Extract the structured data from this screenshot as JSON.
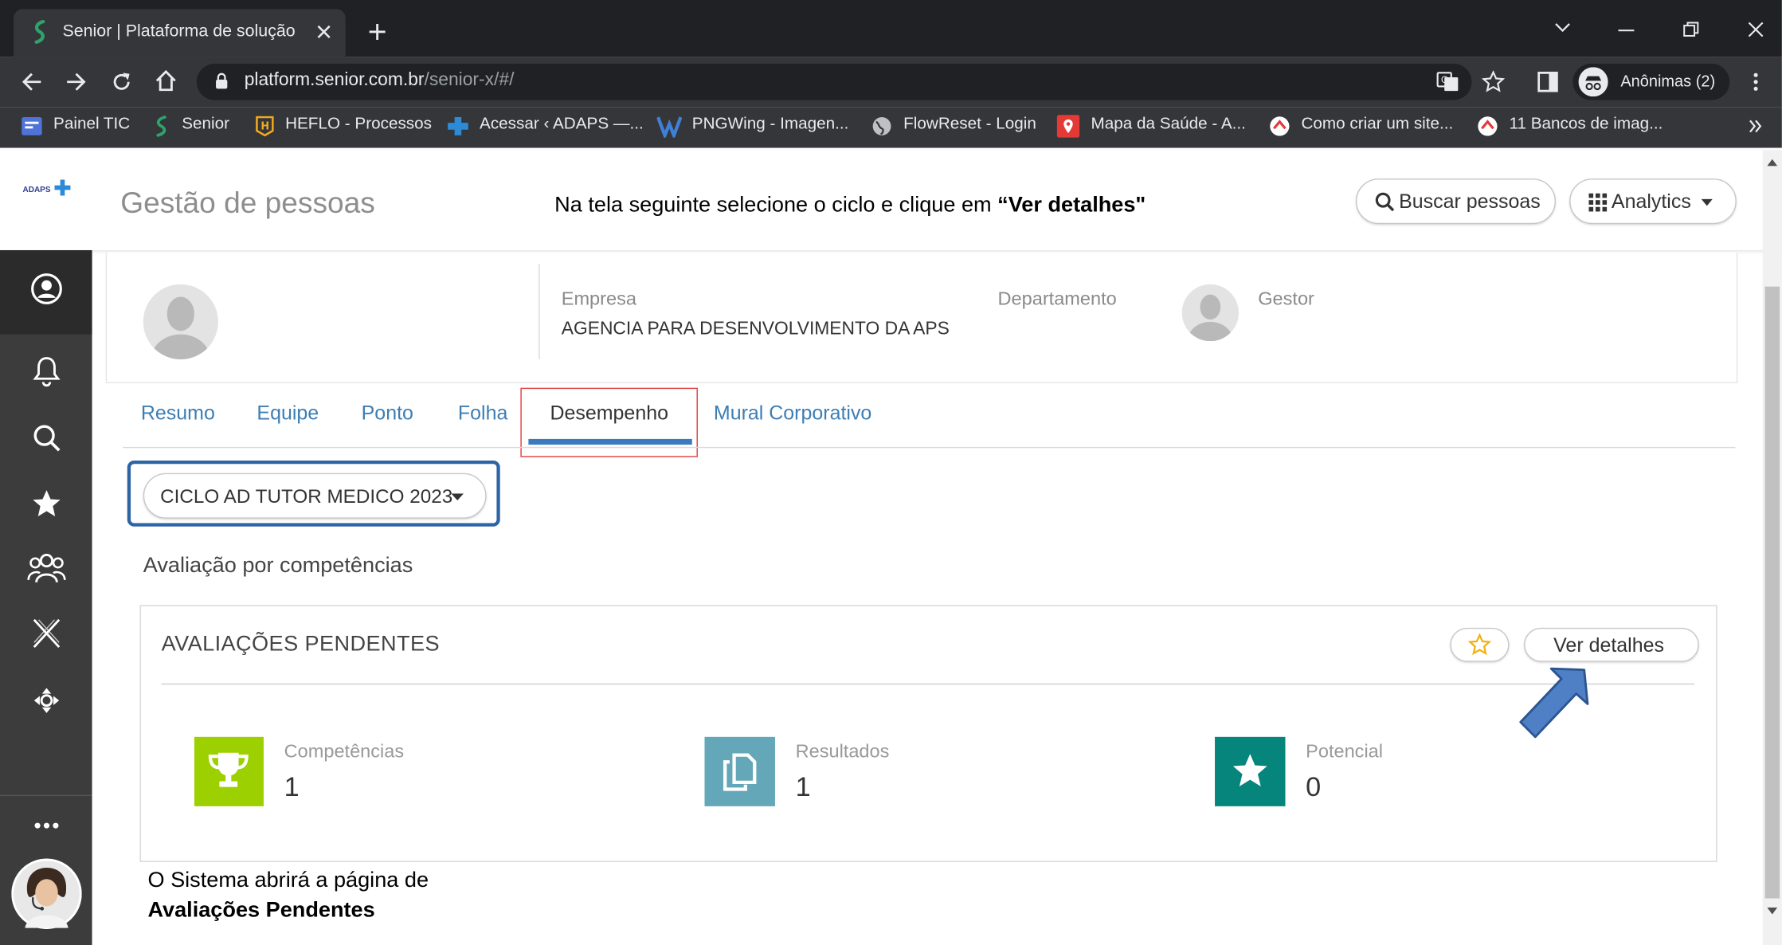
{
  "browser": {
    "tab_title": "Senior | Plataforma de solução",
    "url_host": "platform.senior.com.br",
    "url_path": "/senior-x/#/",
    "profile_label": "Anônimas (2)",
    "bookmarks": [
      {
        "label": "Painel TIC"
      },
      {
        "label": "Senior"
      },
      {
        "label": "HEFLO - Processos"
      },
      {
        "label": "Acessar ‹ ADAPS —..."
      },
      {
        "label": "PNGWing - Imagen..."
      },
      {
        "label": "FlowReset - Login"
      },
      {
        "label": "Mapa da Saúde - A..."
      },
      {
        "label": "Como criar um site..."
      },
      {
        "label": "11 Bancos de imag..."
      }
    ]
  },
  "header": {
    "logo": "ADAPS",
    "title": "Gestão de pessoas",
    "instruction_prefix": "Na tela seguinte selecione o ciclo e clique em ",
    "instruction_bold": "“Ver detalhes\"",
    "search_label": "Buscar pessoas",
    "analytics_label": "Analytics"
  },
  "profile": {
    "empresa_label": "Empresa",
    "empresa_value": "AGENCIA PARA DESENVOLVIMENTO DA APS",
    "departamento_label": "Departamento",
    "gestor_label": "Gestor"
  },
  "tabs": [
    {
      "label": "Resumo"
    },
    {
      "label": "Equipe"
    },
    {
      "label": "Ponto"
    },
    {
      "label": "Folha"
    },
    {
      "label": "Desempenho"
    },
    {
      "label": "Mural Corporativo"
    }
  ],
  "cycle": {
    "selected": "CICLO AD TUTOR MEDICO 2023"
  },
  "section_title": "Avaliação por competências",
  "pending": {
    "title": "AVALIAÇÕES PENDENTES",
    "details_label": "Ver detalhes",
    "stats": [
      {
        "label": "Competências",
        "value": "1",
        "color": "#9dd000",
        "icon": "trophy-icon"
      },
      {
        "label": "Resultados",
        "value": "1",
        "color": "#64a7b8",
        "icon": "copy-icon"
      },
      {
        "label": "Potencial",
        "value": "0",
        "color": "#06857d",
        "icon": "star-icon"
      }
    ]
  },
  "note": {
    "line1": "O Sistema abrirá a página de",
    "line2": "Avaliações Pendentes"
  },
  "colors": {
    "link_blue": "#3d7eb4",
    "active_tab_bar": "#3b7bbd",
    "highlight_red": "#e04040",
    "highlight_blue": "#2d64a5",
    "sidebar": "#3c3c3c"
  }
}
